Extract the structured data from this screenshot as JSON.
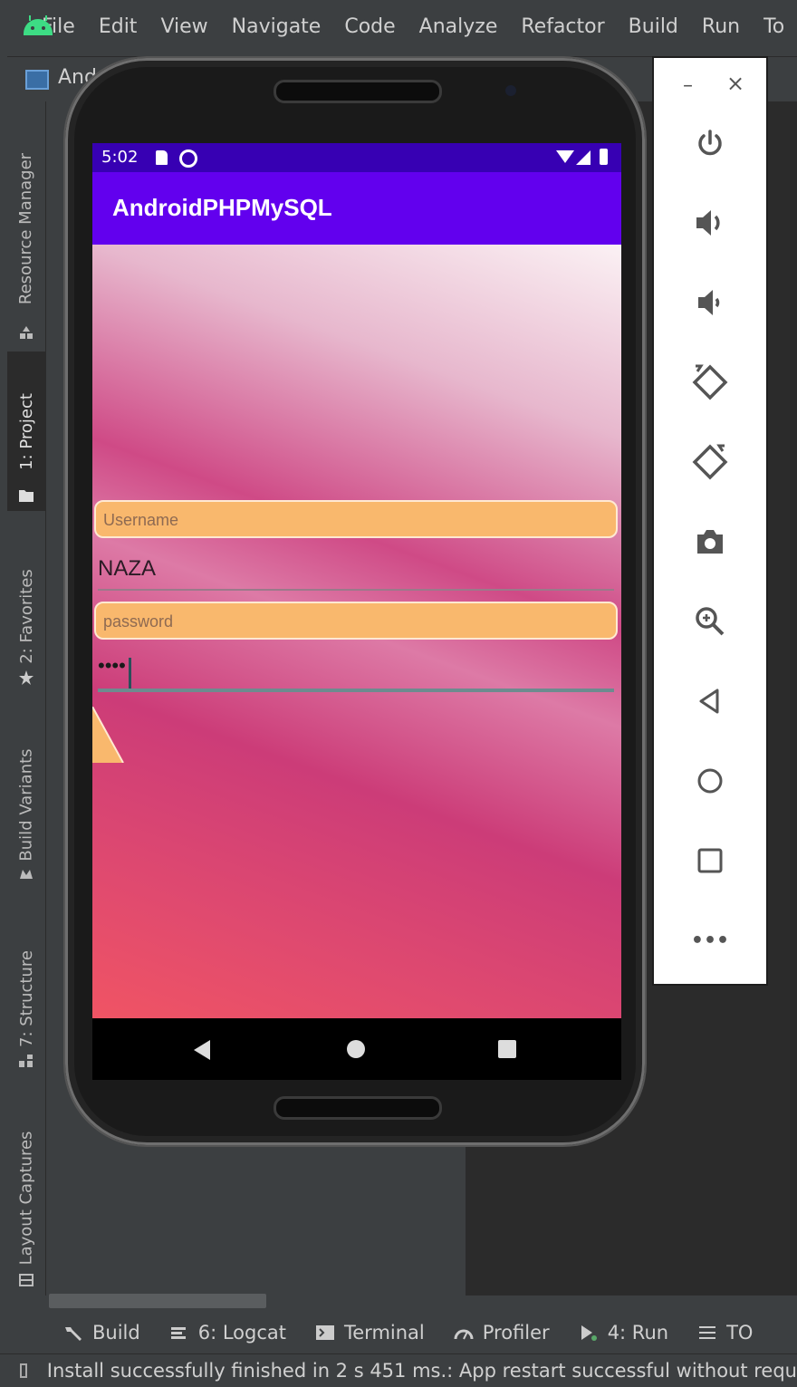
{
  "menu": {
    "items": [
      "File",
      "Edit",
      "View",
      "Navigate",
      "Code",
      "Analyze",
      "Refactor",
      "Build",
      "Run",
      "To"
    ]
  },
  "toolbar2": {
    "project_name": "And"
  },
  "left_tools": {
    "resource_manager": "Resource Manager",
    "project": "1: Project",
    "favorites": "2: Favorites",
    "build_variants": "Build Variants",
    "structure": "7: Structure",
    "layout_captures": "Layout Captures"
  },
  "bottom_tabs": {
    "build": "Build",
    "logcat": "6: Logcat",
    "terminal": "Terminal",
    "profiler": "Profiler",
    "run": "4: Run",
    "todo": "TO"
  },
  "status": {
    "message": "Install successfully finished in 2 s 451 ms.: App restart successful without requ"
  },
  "emulator": {
    "minimize": "–",
    "close": "×",
    "more": "•••"
  },
  "phone": {
    "time": "5:02",
    "app_title": "AndroidPHPMySQL",
    "username_label": "Username",
    "username_value": "NAZA",
    "password_label": "password",
    "password_value": "••••"
  },
  "colors": {
    "app_bar": "#6200ee",
    "status_bar": "#3700b3",
    "field_fill": "#f9b86d",
    "ide_background": "#3c3f41",
    "android_green": "#3ddc84"
  }
}
